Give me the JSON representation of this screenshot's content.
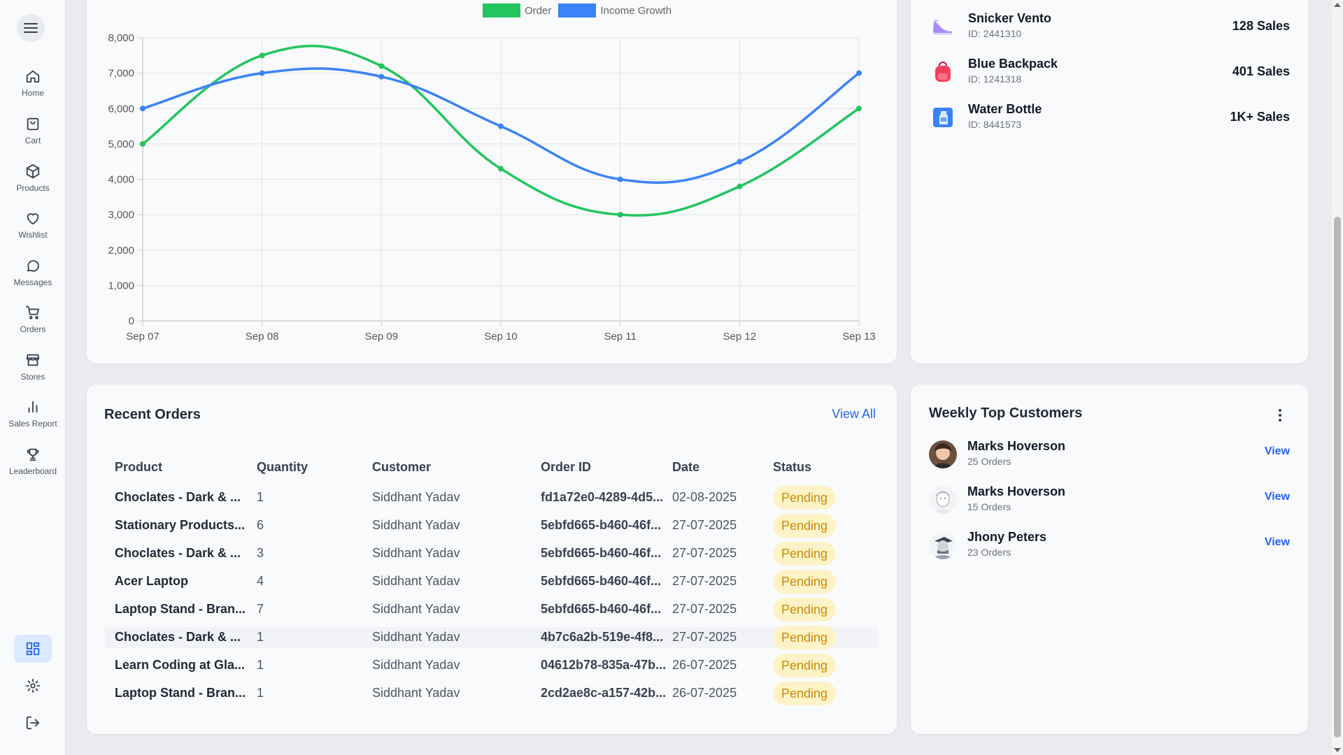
{
  "sidebar": {
    "items": [
      {
        "label": "Home",
        "icon": "home-icon"
      },
      {
        "label": "Cart",
        "icon": "shopping-bag-icon"
      },
      {
        "label": "Products",
        "icon": "box-icon"
      },
      {
        "label": "Wishlist",
        "icon": "heart-icon"
      },
      {
        "label": "Messages",
        "icon": "message-icon"
      },
      {
        "label": "Orders",
        "icon": "cart-icon"
      },
      {
        "label": "Stores",
        "icon": "store-icon"
      },
      {
        "label": "Sales Report",
        "icon": "bar-chart-icon"
      },
      {
        "label": "Leaderboard",
        "icon": "trophy-icon"
      }
    ]
  },
  "colors": {
    "order": "#22c55e",
    "income": "#3b82f6",
    "accent": "#2563eb",
    "pending_bg": "#fef3c7",
    "pending_text": "#ca8a04"
  },
  "chart_data": {
    "type": "line",
    "x": [
      "Sep 07",
      "Sep 08",
      "Sep 09",
      "Sep 10",
      "Sep 11",
      "Sep 12",
      "Sep 13"
    ],
    "series": [
      {
        "name": "Order",
        "values": [
          5000,
          7500,
          7200,
          4300,
          3000,
          3800,
          6000
        ]
      },
      {
        "name": "Income Growth",
        "values": [
          6000,
          7000,
          6900,
          5500,
          4000,
          4500,
          7000
        ]
      }
    ],
    "ylim": [
      0,
      8000
    ],
    "yticks": [
      "0",
      "1,000",
      "2,000",
      "3,000",
      "4,000",
      "5,000",
      "6,000",
      "7,000",
      "8,000"
    ],
    "grid": true,
    "legend": "top-center"
  },
  "top_products": [
    {
      "name": "Snicker Vento",
      "id": "ID: 2441310",
      "sales": "128 Sales",
      "icon": "sneaker-icon"
    },
    {
      "name": "Blue Backpack",
      "id": "ID: 1241318",
      "sales": "401 Sales",
      "icon": "backpack-icon"
    },
    {
      "name": "Water Bottle",
      "id": "ID: 8441573",
      "sales": "1K+ Sales",
      "icon": "water-bottle-icon"
    }
  ],
  "recent_orders": {
    "title": "Recent Orders",
    "view_all": "View All",
    "columns": [
      "Product",
      "Quantity",
      "Customer",
      "Order ID",
      "Date",
      "Status"
    ],
    "rows": [
      {
        "product": "Choclates - Dark & ...",
        "qty": "1",
        "customer": "Siddhant Yadav",
        "order_id": "fd1a72e0-4289-4d5...",
        "date": "02-08-2025",
        "status": "Pending"
      },
      {
        "product": "Stationary Products...",
        "qty": "6",
        "customer": "Siddhant Yadav",
        "order_id": "5ebfd665-b460-46f...",
        "date": "27-07-2025",
        "status": "Pending"
      },
      {
        "product": "Choclates - Dark & ...",
        "qty": "3",
        "customer": "Siddhant Yadav",
        "order_id": "5ebfd665-b460-46f...",
        "date": "27-07-2025",
        "status": "Pending"
      },
      {
        "product": "Acer Laptop",
        "qty": "4",
        "customer": "Siddhant Yadav",
        "order_id": "5ebfd665-b460-46f...",
        "date": "27-07-2025",
        "status": "Pending"
      },
      {
        "product": "Laptop Stand - Bran...",
        "qty": "7",
        "customer": "Siddhant Yadav",
        "order_id": "5ebfd665-b460-46f...",
        "date": "27-07-2025",
        "status": "Pending"
      },
      {
        "product": "Choclates - Dark & ...",
        "qty": "1",
        "customer": "Siddhant Yadav",
        "order_id": "4b7c6a2b-519e-4f8...",
        "date": "27-07-2025",
        "status": "Pending"
      },
      {
        "product": "Learn Coding at Gla...",
        "qty": "1",
        "customer": "Siddhant Yadav",
        "order_id": "04612b78-835a-47b...",
        "date": "26-07-2025",
        "status": "Pending"
      },
      {
        "product": "Laptop Stand - Bran...",
        "qty": "1",
        "customer": "Siddhant Yadav",
        "order_id": "2cd2ae8c-a157-42b...",
        "date": "26-07-2025",
        "status": "Pending"
      }
    ]
  },
  "top_customers": {
    "title": "Weekly Top Customers",
    "customers": [
      {
        "name": "Marks Hoverson",
        "orders": "25 Orders",
        "action": "View"
      },
      {
        "name": "Marks Hoverson",
        "orders": "15 Orders",
        "action": "View"
      },
      {
        "name": "Jhony Peters",
        "orders": "23 Orders",
        "action": "View"
      }
    ]
  }
}
